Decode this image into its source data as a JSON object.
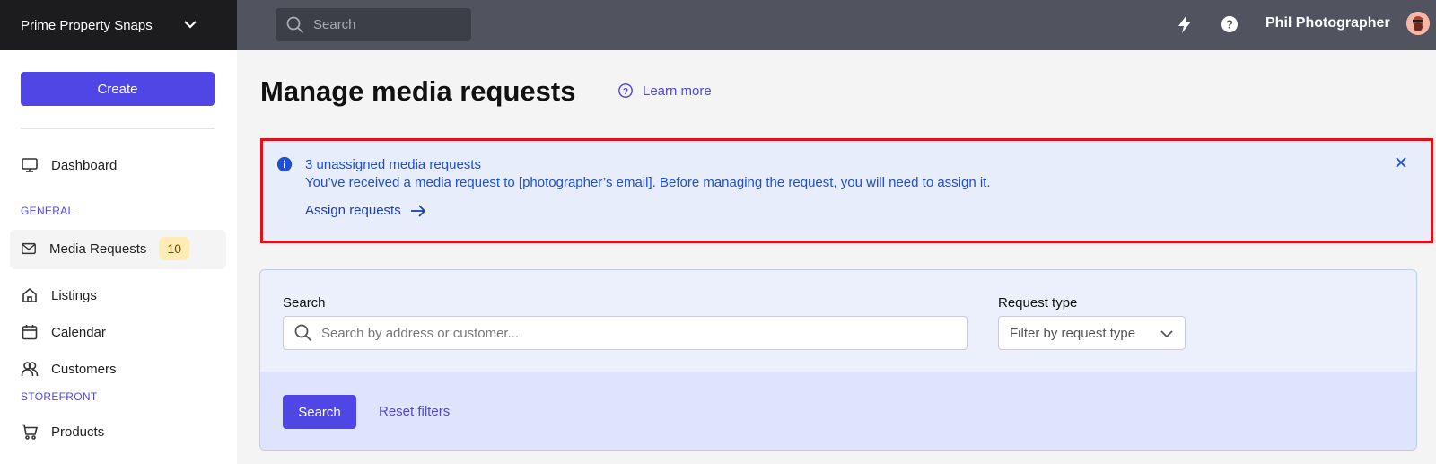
{
  "header": {
    "workspace_name": "Prime Property Snaps",
    "search_placeholder": "Search",
    "user_name": "Phil Photographer"
  },
  "sidebar": {
    "create_label": "Create",
    "dashboard_label": "Dashboard",
    "section_general": "GENERAL",
    "media_requests_label": "Media Requests",
    "media_requests_count": "10",
    "listings_label": "Listings",
    "calendar_label": "Calendar",
    "customers_label": "Customers",
    "section_storefront": "STOREFRONT",
    "products_label": "Products"
  },
  "main": {
    "title": "Manage media requests",
    "learn_more": "Learn more"
  },
  "alert": {
    "title": "3 unassigned media requests",
    "description": "You’ve received a media request to [photographer’s email]. Before managing the request, you will need to assign it.",
    "action": "Assign requests"
  },
  "filters": {
    "search_label": "Search",
    "search_placeholder": "Search by address or customer...",
    "request_type_label": "Request type",
    "request_type_placeholder": "Filter by request type",
    "search_button": "Search",
    "reset_link": "Reset filters"
  },
  "colors": {
    "accent": "#5046e5",
    "topbar": "#51535e",
    "brand_bg": "#1c1c1f",
    "alert_bg": "#e7edfb",
    "highlight_border": "#e0101a"
  },
  "icons": [
    "chevron-down-icon",
    "search-icon",
    "lightning-icon",
    "help-icon",
    "avatar",
    "question-circle-icon",
    "monitor-icon",
    "mail-icon",
    "home-icon",
    "calendar-icon",
    "users-icon",
    "cart-icon",
    "info-icon",
    "close-icon",
    "arrow-right-icon"
  ]
}
